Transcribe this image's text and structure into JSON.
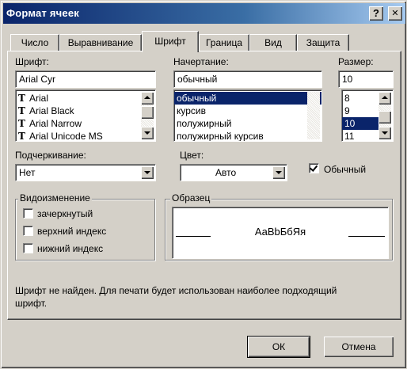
{
  "window": {
    "title": "Формат ячеек",
    "help_btn": "?",
    "close_btn": "✕"
  },
  "tabs": [
    "Число",
    "Выравнивание",
    "Шрифт",
    "Граница",
    "Вид",
    "Защита"
  ],
  "active_tab": "Шрифт",
  "font": {
    "label": "Шрифт:",
    "value": "Arial Cyr",
    "options": [
      "Arial",
      "Arial Black",
      "Arial Narrow",
      "Arial Unicode MS"
    ],
    "icon": "truetype-icon"
  },
  "style": {
    "label": "Начертание:",
    "value": "обычный",
    "options": [
      "обычный",
      "курсив",
      "полужирный",
      "полужирный курсив"
    ],
    "selected": "обычный"
  },
  "size": {
    "label": "Размер:",
    "value": "10",
    "options": [
      "8",
      "9",
      "10",
      "11"
    ],
    "selected": "10"
  },
  "underline": {
    "label": "Подчеркивание:",
    "value": "Нет"
  },
  "color": {
    "label": "Цвет:",
    "value": "Авто"
  },
  "normal_font": {
    "label": "Обычный",
    "checked": true
  },
  "effects": {
    "title": "Видоизменение",
    "strikethrough": "зачеркнутый",
    "superscript": "верхний индекс",
    "subscript": "нижний индекс"
  },
  "sample": {
    "title": "Образец",
    "text": "АаВbБбЯя"
  },
  "info_text": "Шрифт не найден. Для печати будет использован наиболее подходящий шрифт.",
  "buttons": {
    "ok": "ОК",
    "cancel": "Отмена"
  },
  "colors": {
    "title_start": "#0a246a",
    "title_end": "#a6caf0",
    "selection": "#0a246a",
    "face": "#d4d0c8"
  }
}
